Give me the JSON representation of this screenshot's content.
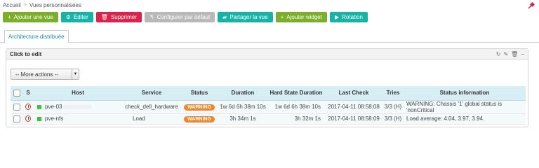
{
  "breadcrumb": {
    "home": "Accueil",
    "current": "Vues personnalisées"
  },
  "toolbar": {
    "add_view": "Ajouter une vue",
    "edit": "Éditer",
    "delete": "Supprimer",
    "configure_default": "Configurer par défaut",
    "share_view": "Partager la vue",
    "add_widget": "Ajouter widget",
    "rotation": "Rotation"
  },
  "tabs": [
    {
      "label": "Architecture distribuée"
    }
  ],
  "panel": {
    "title": "Click to edit"
  },
  "actions": {
    "more_label": "-- More actions --"
  },
  "table": {
    "headers": {
      "s": "S",
      "host": "Host",
      "service": "Service",
      "status": "Status",
      "duration": "Duration",
      "hard_state_duration": "Hard State Duration",
      "last_check": "Last Check",
      "tries": "Tries",
      "status_information": "Status information"
    },
    "rows": [
      {
        "host": "pve-03",
        "service": "check_dell_hardware",
        "status": "WARNING",
        "duration": "1w 6d 6h 38m 10s",
        "hard_state_duration": "1w 6d 6h 38m 10s",
        "last_check": "2017-04-11 08:58:08",
        "tries": "3/3 (H)",
        "info": "WARNING: Chassis '1' global status is 'nonCritical"
      },
      {
        "host": "pve-nfs",
        "service": "Load",
        "status": "WARNING",
        "duration": "3h 34m 1s",
        "hard_state_duration": "3h 32m 1s",
        "last_check": "2017-04-11 08:58:09",
        "tries": "3/3 (H)",
        "info": "Load average: 4.04, 3.97, 3.94."
      }
    ]
  },
  "colors": {
    "green": "#7cae2b",
    "teal": "#17b3a7",
    "red": "#d9224c",
    "grey": "#b9b9b9",
    "warning": "#f0862b"
  }
}
